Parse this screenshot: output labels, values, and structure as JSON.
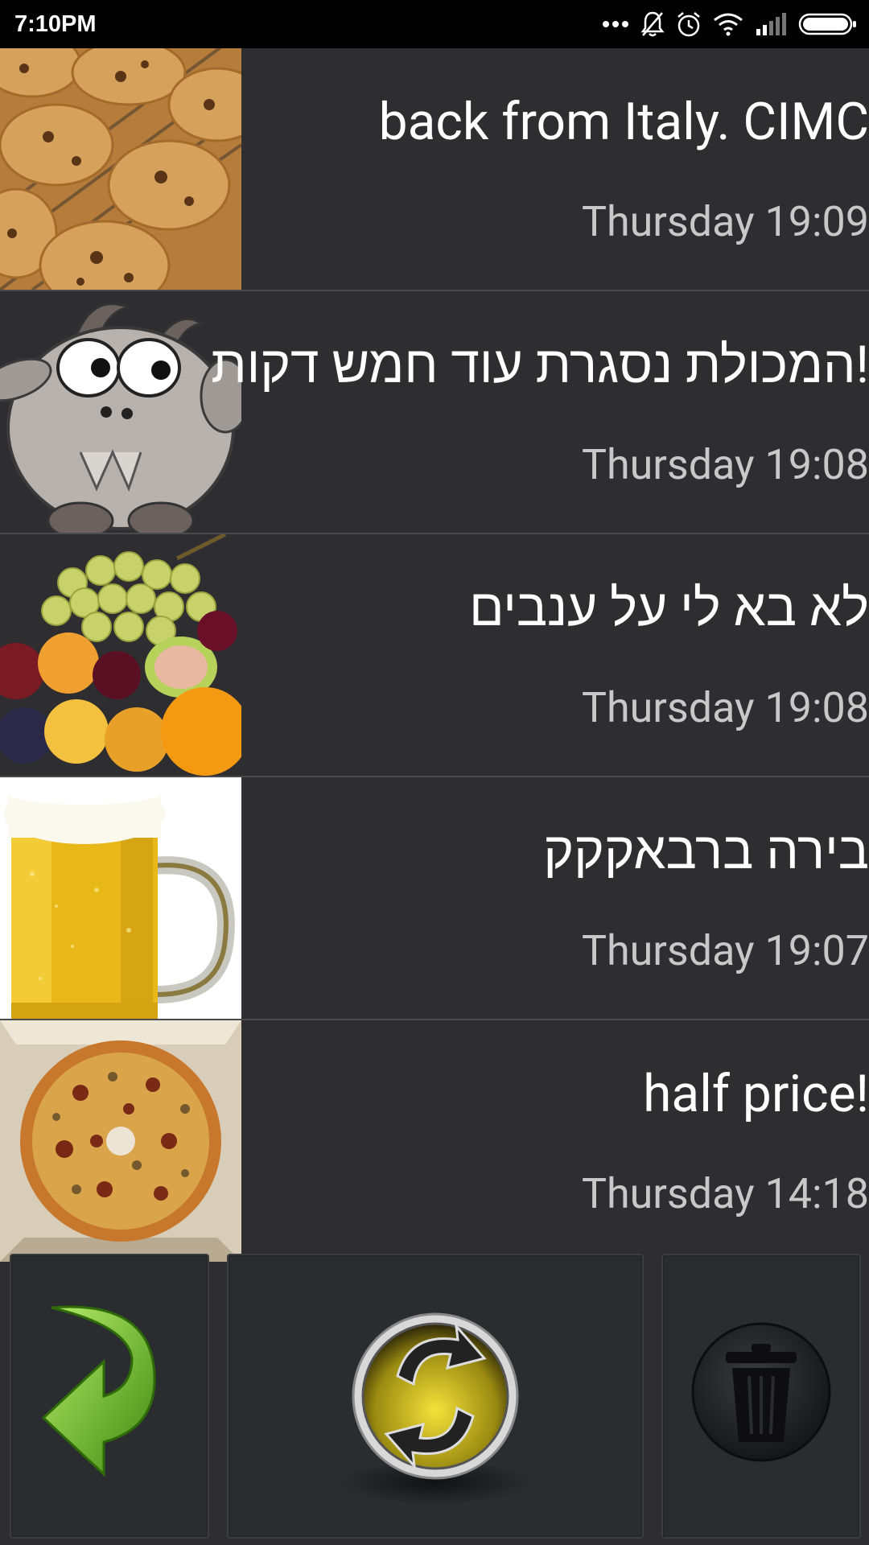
{
  "status_bar": {
    "time": "7:10PM",
    "icons": [
      "more-dots-icon",
      "bell-off-icon",
      "alarm-icon",
      "wifi-icon",
      "signal-icon",
      "battery-icon"
    ]
  },
  "messages": [
    {
      "text": "back from Italy. CIMC",
      "timestamp": "Thursday 19:09",
      "image": "cookies"
    },
    {
      "text": "המכולת נסגרת עוד חמש דקות!",
      "timestamp": "Thursday 19:08",
      "image": "goat"
    },
    {
      "text": "לא בא לי על ענבים",
      "timestamp": "Thursday 19:08",
      "image": "fruit"
    },
    {
      "text": "בירה ברבאקקק",
      "timestamp": "Thursday 19:07",
      "image": "beer"
    },
    {
      "text": "half price!",
      "timestamp": "Thursday 14:18",
      "image": "pizza"
    }
  ],
  "buttons": {
    "reply": "reply-arrow-icon",
    "refresh": "refresh-icon",
    "delete": "trash-icon"
  },
  "colors": {
    "background": "#2e2e30",
    "timestamp": "#c8c8c8",
    "refresh_gold": "#d8c21a",
    "reply_green": "#6cc02a"
  }
}
